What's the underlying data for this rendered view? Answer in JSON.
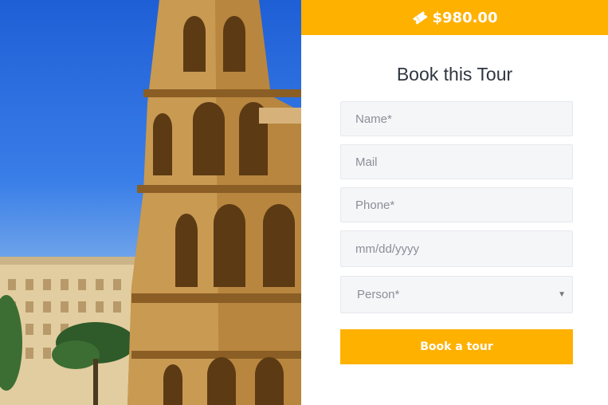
{
  "price": {
    "icon": "ticket-icon",
    "amount": "$980.00"
  },
  "booking": {
    "title": "Book this Tour",
    "fields": {
      "name_placeholder": "Name*",
      "mail_placeholder": "Mail",
      "phone_placeholder": "Phone*",
      "date_placeholder": "mm/dd/yyyy"
    },
    "person_select": {
      "value": "Person*",
      "icon": "caret-down-icon"
    },
    "submit_label": "Book a tour"
  },
  "colors": {
    "accent": "#ffb100",
    "field_bg": "#f5f6f8",
    "title": "#2f3640"
  }
}
